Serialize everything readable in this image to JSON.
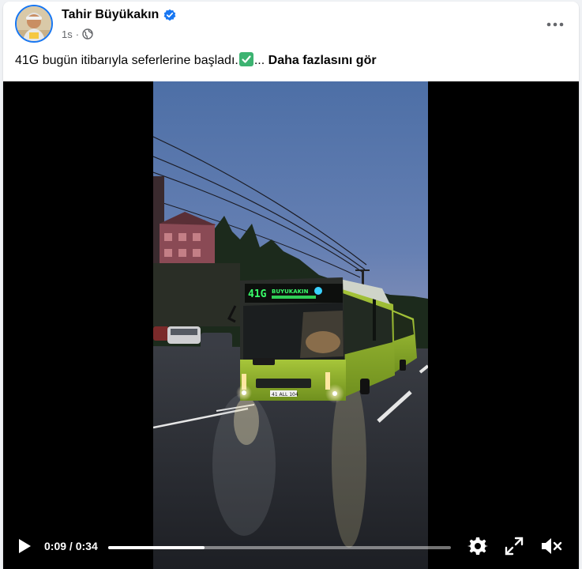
{
  "post": {
    "author": "Tahir Büyükakın",
    "verified": true,
    "time": "1s",
    "separator": "·",
    "text": "41G bugün itibarıyla seferlerine başladı.",
    "ellipsis": "...",
    "see_more": "Daha fazlasını gör"
  },
  "icons": {
    "verified": "verified-badge-icon",
    "audience": "globe-icon",
    "more": "more-options-icon",
    "emoji": "check-mark-button-emoji"
  },
  "video": {
    "current_time": "0:09",
    "time_separator": " / ",
    "duration": "0:34",
    "progress": 0.28,
    "bus_sign_route": "41G",
    "bus_sign_text": "BUYUKAKIN",
    "controls": [
      "play-icon",
      "settings-icon",
      "fullscreen-icon",
      "mute-icon"
    ]
  },
  "colors": {
    "brand": "#1877f2",
    "bus_green": "#8fb52a",
    "sign_green": "#39ff6a",
    "sky_top": "#4d6fa6"
  }
}
